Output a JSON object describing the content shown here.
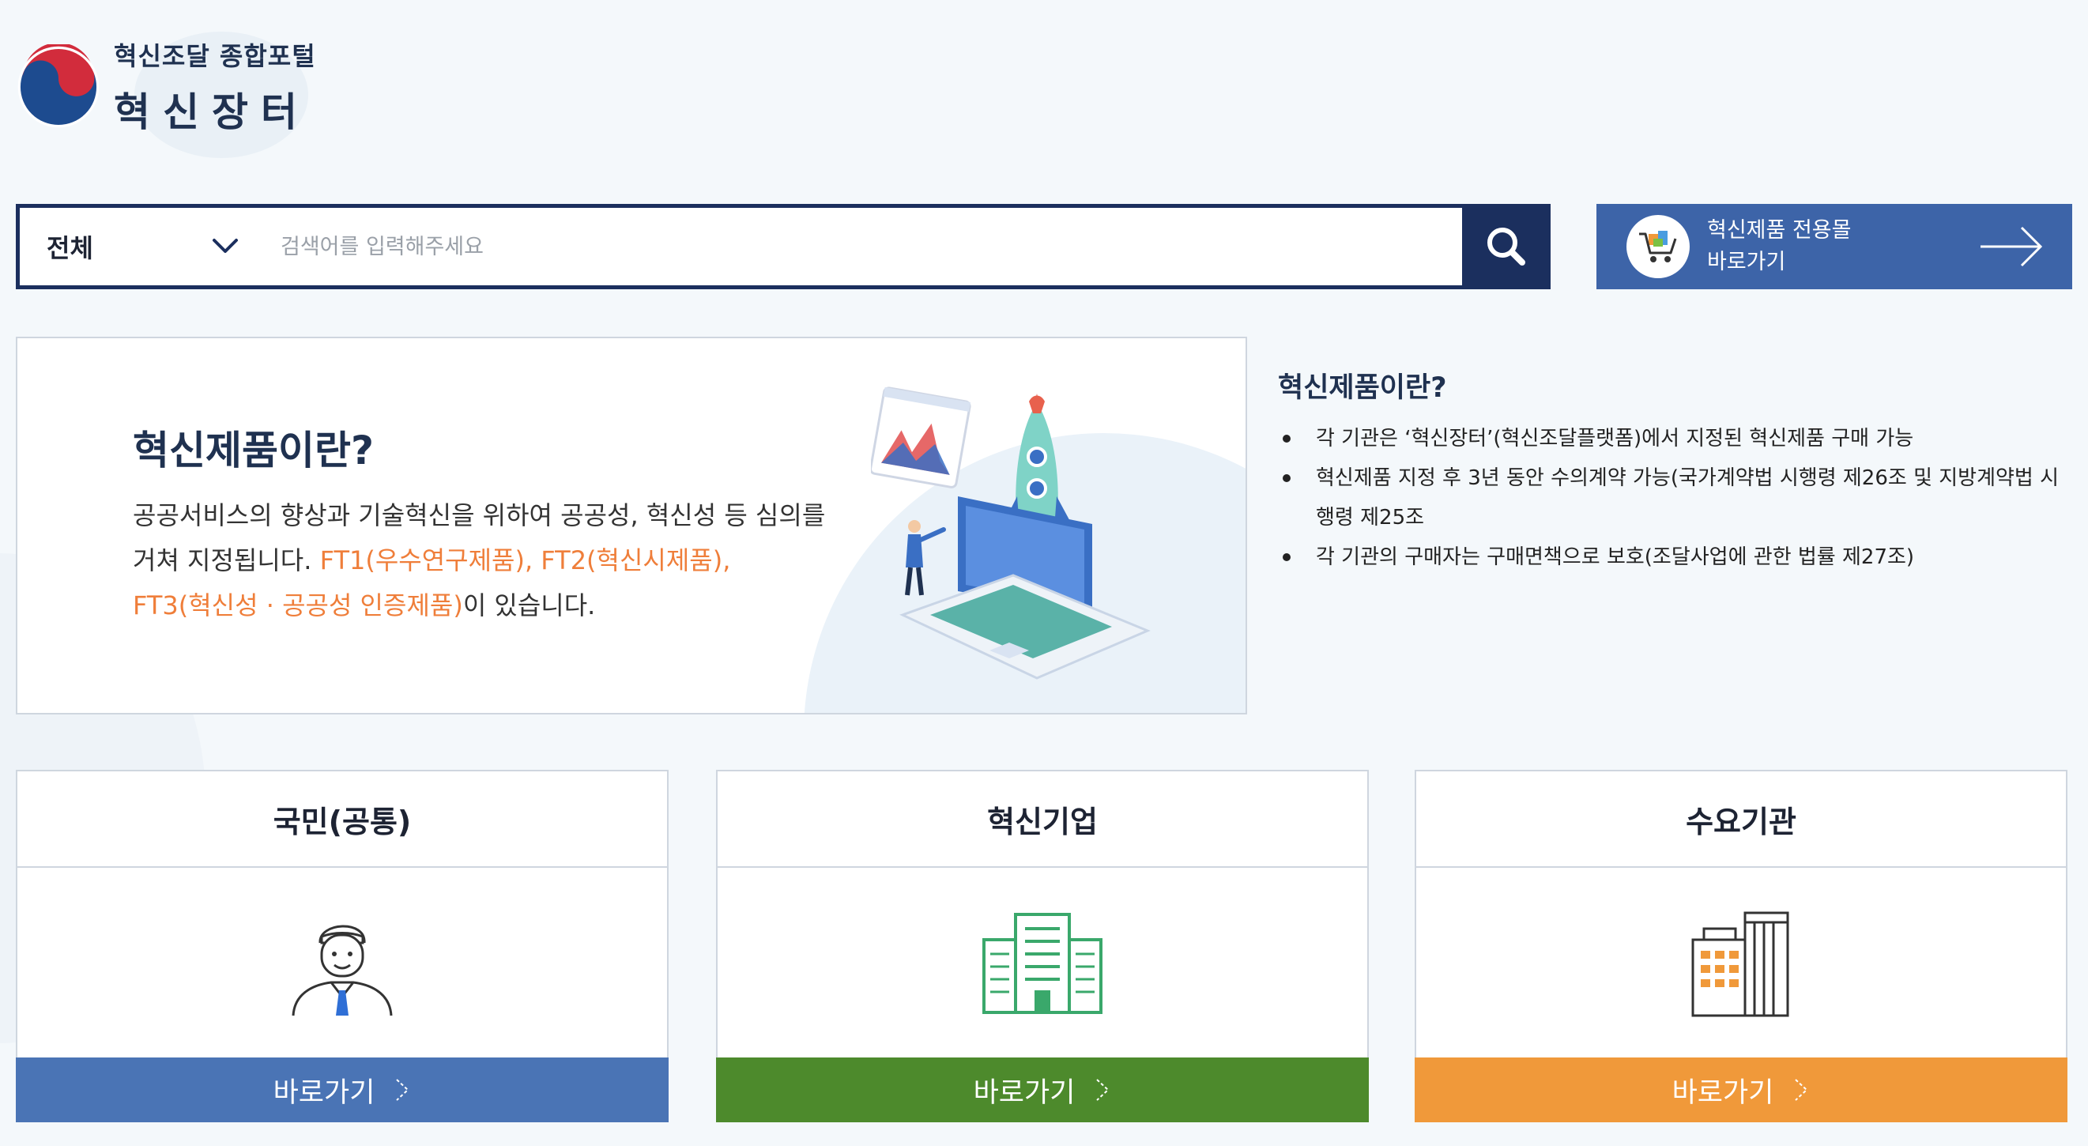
{
  "logo": {
    "subtitle": "혁신조달 종합포털",
    "title": "혁신장터"
  },
  "search": {
    "category": "전체",
    "placeholder": "검색어를 입력해주세요"
  },
  "mall": {
    "line1": "혁신제품 전용몰",
    "line2": "바로가기"
  },
  "banner": {
    "title": "혁신제품이란?",
    "desc_1": "공공서비스의 향상과 기술혁신을 위하여 공공성, 혁신성 등 심의를",
    "desc_2": "거쳐 지정됩니다. ",
    "highlight_1": "FT1(우수연구제품), FT2(혁신시제품),",
    "highlight_2": "FT3(혁신성 · 공공성 인증제품)",
    "desc_3": "이 있습니다."
  },
  "info": {
    "title": "혁신제품이란?",
    "items": [
      "각 기관은 ‘혁신장터’(혁신조달플랫폼)에서 지정된 혁신제품 구매 가능",
      "혁신제품 지정 후 3년 동안 수의계약 가능(국가계약법 시행령 제26조 및 지방계약법 시행령 제25조",
      "각 기관의 구매자는 구매면책으로 보호(조달사업에 관한 법률 제27조)"
    ]
  },
  "cards": [
    {
      "title": "국민(공통)",
      "button": "바로가기",
      "icon": "person-icon",
      "color": "#4a74b5"
    },
    {
      "title": "혁신기업",
      "button": "바로가기",
      "icon": "green-building-icon",
      "color": "#4d8a2c"
    },
    {
      "title": "수요기관",
      "button": "바로가기",
      "icon": "office-building-icon",
      "color": "#f0993a"
    }
  ],
  "colors": {
    "navy": "#1b2f5e",
    "mall_blue": "#3d64a8",
    "highlight_orange": "#ef7e3a"
  }
}
